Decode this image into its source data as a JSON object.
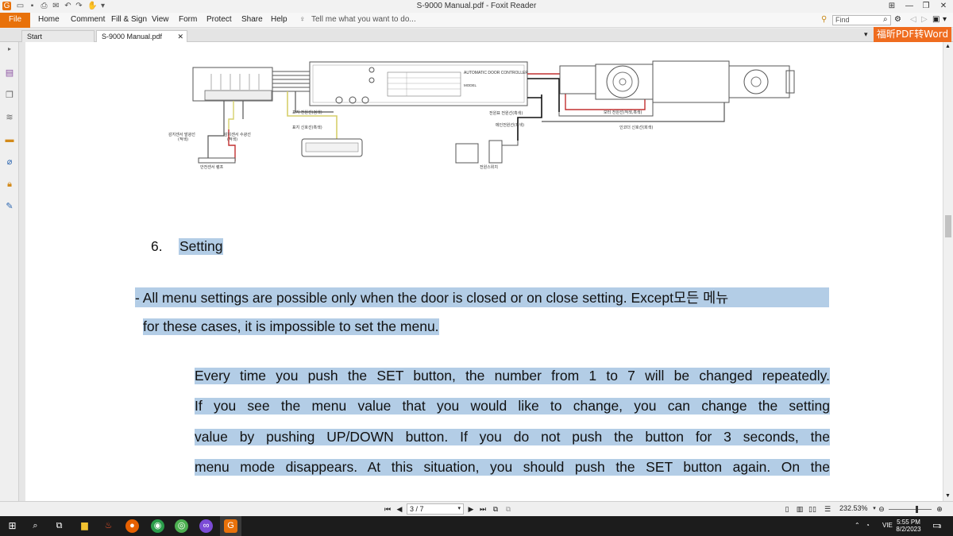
{
  "window": {
    "title": "S-9000 Manual.pdf - Foxit Reader"
  },
  "ribbon": {
    "file": "File",
    "tabs": [
      "Home",
      "Comment",
      "Fill & Sign",
      "View",
      "Form",
      "Protect",
      "Share",
      "Help"
    ],
    "tell_me_placeholder": "Tell me what you want to do...",
    "find_placeholder": "Find"
  },
  "doc_tabs": {
    "start": "Start",
    "active": "S-9000 Manual.pdf",
    "convert_button": "福昕PDF转Word"
  },
  "diagram_labels": {
    "controller_title": "AUTOMATIC DOOR CONTROLLER",
    "model": "MODEL",
    "wire_1": "표지 전원선(검색)",
    "wire_2": "표지 신호선(흑색)",
    "main_power": "전원표 전원선(흑색)",
    "power_cable": "메인전원선(흑색)",
    "motor_power": "모터 전원선(적색,흑색)",
    "encoder": "인코더 신호선(회색)",
    "sensor_tx": "감지센서 발광선",
    "sensor_rx": "감지센서 수광선",
    "sensor_type": "(적색)",
    "sensor_type_2": "(적색)",
    "safety": "안전센서 램프",
    "power_switch": "전원스위치"
  },
  "document": {
    "section_number": "6.",
    "section_title": "Setting",
    "para1_line1": "- All menu settings are possible only when the door is closed or on close setting. Except모든 메뉴",
    "para1_line2": "for these cases, it is impossible to set the menu.",
    "para2_lines": [
      "Every time you push the SET button, the number from 1 to 7 will be changed repeatedly.",
      "If you see the menu value that you would like to change, you can change the setting",
      "value by pushing UP/DOWN button. If you do not push the button for 3 seconds, the",
      "menu mode disappears. At this situation, you should push the SET button again. On the"
    ]
  },
  "status": {
    "page_value": "3 / 7",
    "zoom": "232.53%"
  },
  "taskbar": {
    "language": "VIE",
    "time": "5:55 PM",
    "date": "8/2/2023",
    "notifications": "3"
  }
}
